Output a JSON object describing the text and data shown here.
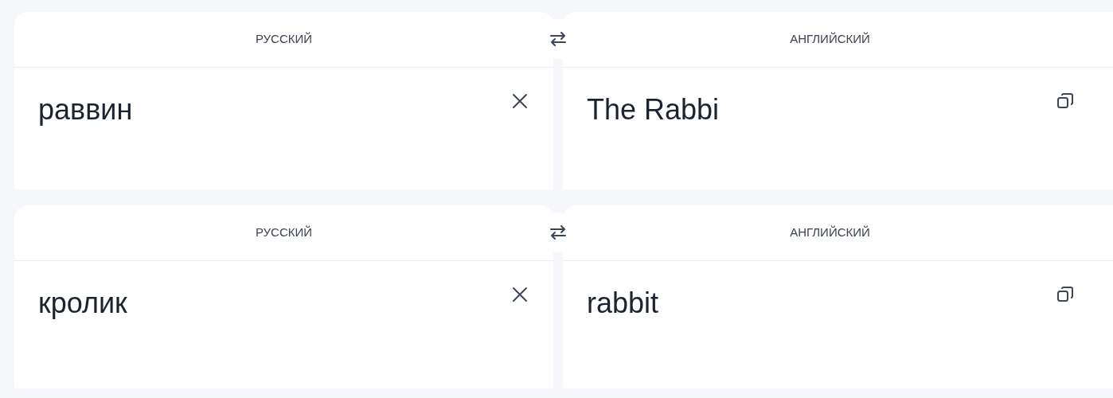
{
  "panels": [
    {
      "source": {
        "language": "РУССКИЙ",
        "text": "раввин"
      },
      "target": {
        "language": "АНГЛИЙСКИЙ",
        "text": "The Rabbi"
      }
    },
    {
      "source": {
        "language": "РУССКИЙ",
        "text": "кролик"
      },
      "target": {
        "language": "АНГЛИЙСКИЙ",
        "text": "rabbit"
      }
    }
  ]
}
